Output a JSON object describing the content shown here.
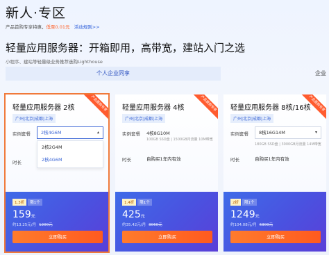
{
  "header": {
    "title": "新人·专区",
    "promo_text": "产品首购专享特惠，",
    "promo_price": "低至0.01元",
    "rule_link": "活动规则>>",
    "headline": "轻量应用服务器：开箱即用，高带宽，建站入门之选",
    "description": "小程序、建站等轻量级业务推荐选购Lighthouse"
  },
  "tabs": [
    {
      "label": "个人企业同享"
    },
    {
      "label": "企业"
    }
  ],
  "colors": {
    "accent_blue": "#3c67d6",
    "accent_orange": "#ff5a1f",
    "selected_outline": "#f07a3b"
  },
  "cards": [
    {
      "title": "轻量应用服务器 2核",
      "ribbon": "产品首购专享",
      "region": "广州|北京|成都|上海",
      "spec_label": "实例套餐",
      "spec_value": "2核4G6M",
      "dropdown_options": [
        "2核2G4M",
        "2核4G6M"
      ],
      "duration_label": "时长",
      "discount": "1.3折",
      "period": "限1个",
      "price": "159",
      "price_unit": "元",
      "per_month": "约13.25元/月",
      "original": "1200元",
      "buy_label": "立即购买"
    },
    {
      "title": "轻量应用服务器 4核",
      "ribbon": "产品首购专享",
      "region": "广州|北京|成都|上海",
      "spec_label": "实例套餐",
      "spec_value": "4核8G10M",
      "spec_detail": "100GB SSD盘 | 1500GB月流量 10M带宽",
      "duration_label": "时长",
      "duration_value": "自购买1年内有效",
      "discount": "1.4折",
      "period": "限1个",
      "price": "425",
      "price_unit": "元",
      "per_month": "约35.42元/月",
      "original": "3060元",
      "buy_label": "立即购买"
    },
    {
      "title": "轻量应用服务器 8核/16核",
      "ribbon": "产品首购专享",
      "region": "广州|北京|成都|上海",
      "spec_label": "实例套餐",
      "spec_value": "8核16G14M",
      "spec_detail": "180GB SSD盘 | 3000GB月流量 14M带宽",
      "duration_label": "时长",
      "duration_value": "自购买1年内有效",
      "discount": "2折",
      "period": "限1个",
      "price": "1249",
      "price_unit": "元",
      "per_month": "约104.08元/月",
      "original": "6300元",
      "buy_label": "立即购买"
    }
  ]
}
